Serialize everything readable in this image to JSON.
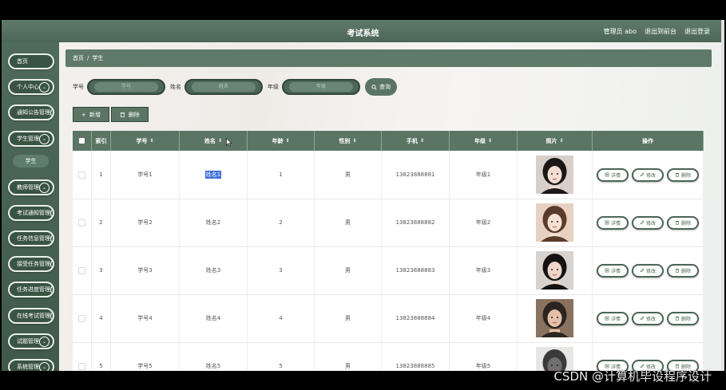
{
  "app": {
    "title": "考试系统",
    "nav": [
      "管理员 abo",
      "退出到前台",
      "退出登录"
    ]
  },
  "sidebar": {
    "items": [
      {
        "label": "首页",
        "has_chevron": false
      },
      {
        "label": "个人中心",
        "has_chevron": true
      },
      {
        "label": "通知公告管理",
        "has_chevron": true
      },
      {
        "label": "学生管理",
        "has_chevron": true
      },
      {
        "label": "教师管理",
        "has_chevron": true
      },
      {
        "label": "考试通知管理",
        "has_chevron": true
      },
      {
        "label": "任务信息管理",
        "has_chevron": true
      },
      {
        "label": "接受任务管理",
        "has_chevron": true
      },
      {
        "label": "任务进度管理",
        "has_chevron": true
      },
      {
        "label": "在线考试管理",
        "has_chevron": true
      },
      {
        "label": "试题管理",
        "has_chevron": true
      },
      {
        "label": "系统管理",
        "has_chevron": true
      }
    ],
    "subitem": "学生",
    "chevron_icon": "chevron-down-icon"
  },
  "breadcrumb": {
    "home": "首页",
    "sep": "/",
    "current": "学生"
  },
  "search": {
    "fields": [
      {
        "label": "学号",
        "placeholder": "学号"
      },
      {
        "label": "姓名",
        "placeholder": "姓名"
      },
      {
        "label": "年级",
        "placeholder": "年级"
      }
    ],
    "button": "查询"
  },
  "actions": {
    "add": "新增",
    "delete": "删除"
  },
  "table": {
    "columns": [
      "索引",
      "学号",
      "姓名",
      "年龄",
      "性别",
      "手机",
      "年级",
      "照片",
      "操作"
    ],
    "sortable": [
      false,
      true,
      true,
      true,
      true,
      true,
      true,
      true,
      false
    ],
    "sort_icon": "⇕",
    "rows": [
      {
        "index": "1",
        "sid": "学号1",
        "name": "姓名1",
        "age": "1",
        "gender": "男",
        "phone": "13823888881",
        "grade": "年级1",
        "name_selected": true
      },
      {
        "index": "2",
        "sid": "学号2",
        "name": "姓名2",
        "age": "2",
        "gender": "男",
        "phone": "13823888882",
        "grade": "年级2",
        "name_selected": false
      },
      {
        "index": "3",
        "sid": "学号3",
        "name": "姓名3",
        "age": "3",
        "gender": "男",
        "phone": "13823888883",
        "grade": "年级3",
        "name_selected": false
      },
      {
        "index": "4",
        "sid": "学号4",
        "name": "姓名4",
        "age": "4",
        "gender": "男",
        "phone": "13823888884",
        "grade": "年级4",
        "name_selected": false
      },
      {
        "index": "5",
        "sid": "学号5",
        "name": "姓名5",
        "age": "5",
        "gender": "男",
        "phone": "13823888885",
        "grade": "年级5",
        "name_selected": false
      }
    ],
    "row_actions": [
      "详情",
      "修改",
      "删除"
    ]
  },
  "watermark": "CSDN @计算机毕设程序设计",
  "colors": {
    "accent": "#5b7565",
    "dark": "#40594a",
    "selection": "#3c6fd8"
  }
}
